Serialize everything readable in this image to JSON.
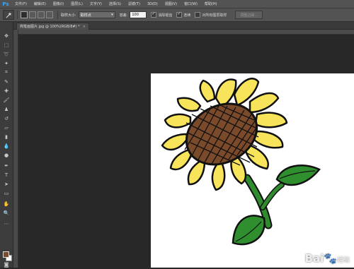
{
  "app": {
    "logo": "Ps"
  },
  "menu": [
    "文件(F)",
    "编辑(E)",
    "图像(I)",
    "图层(L)",
    "文字(Y)",
    "选择(S)",
    "滤镜(T)",
    "3D(D)",
    "视图(V)",
    "窗口(W)",
    "帮助(H)"
  ],
  "options": {
    "sample_size_label": "取样大小:",
    "sample_size_value": "取样点",
    "tolerance_label": "容差:",
    "tolerance_value": "100",
    "anti_alias_label": "消除锯齿",
    "contiguous_label": "连续",
    "sample_all_label": "对所有图层取样",
    "refine_edge_label": "调整边缘..."
  },
  "document": {
    "tab_title": "简笔画图片.jpg @ 100%(RGB/8#) *",
    "close_glyph": "×"
  },
  "colors": {
    "foreground": "#7a4a2a",
    "background": "#ffffff"
  },
  "watermark": {
    "brand": "Bai",
    "paw": "🐾",
    "sub": "经验",
    "url": "jingyan.baidu.com"
  }
}
